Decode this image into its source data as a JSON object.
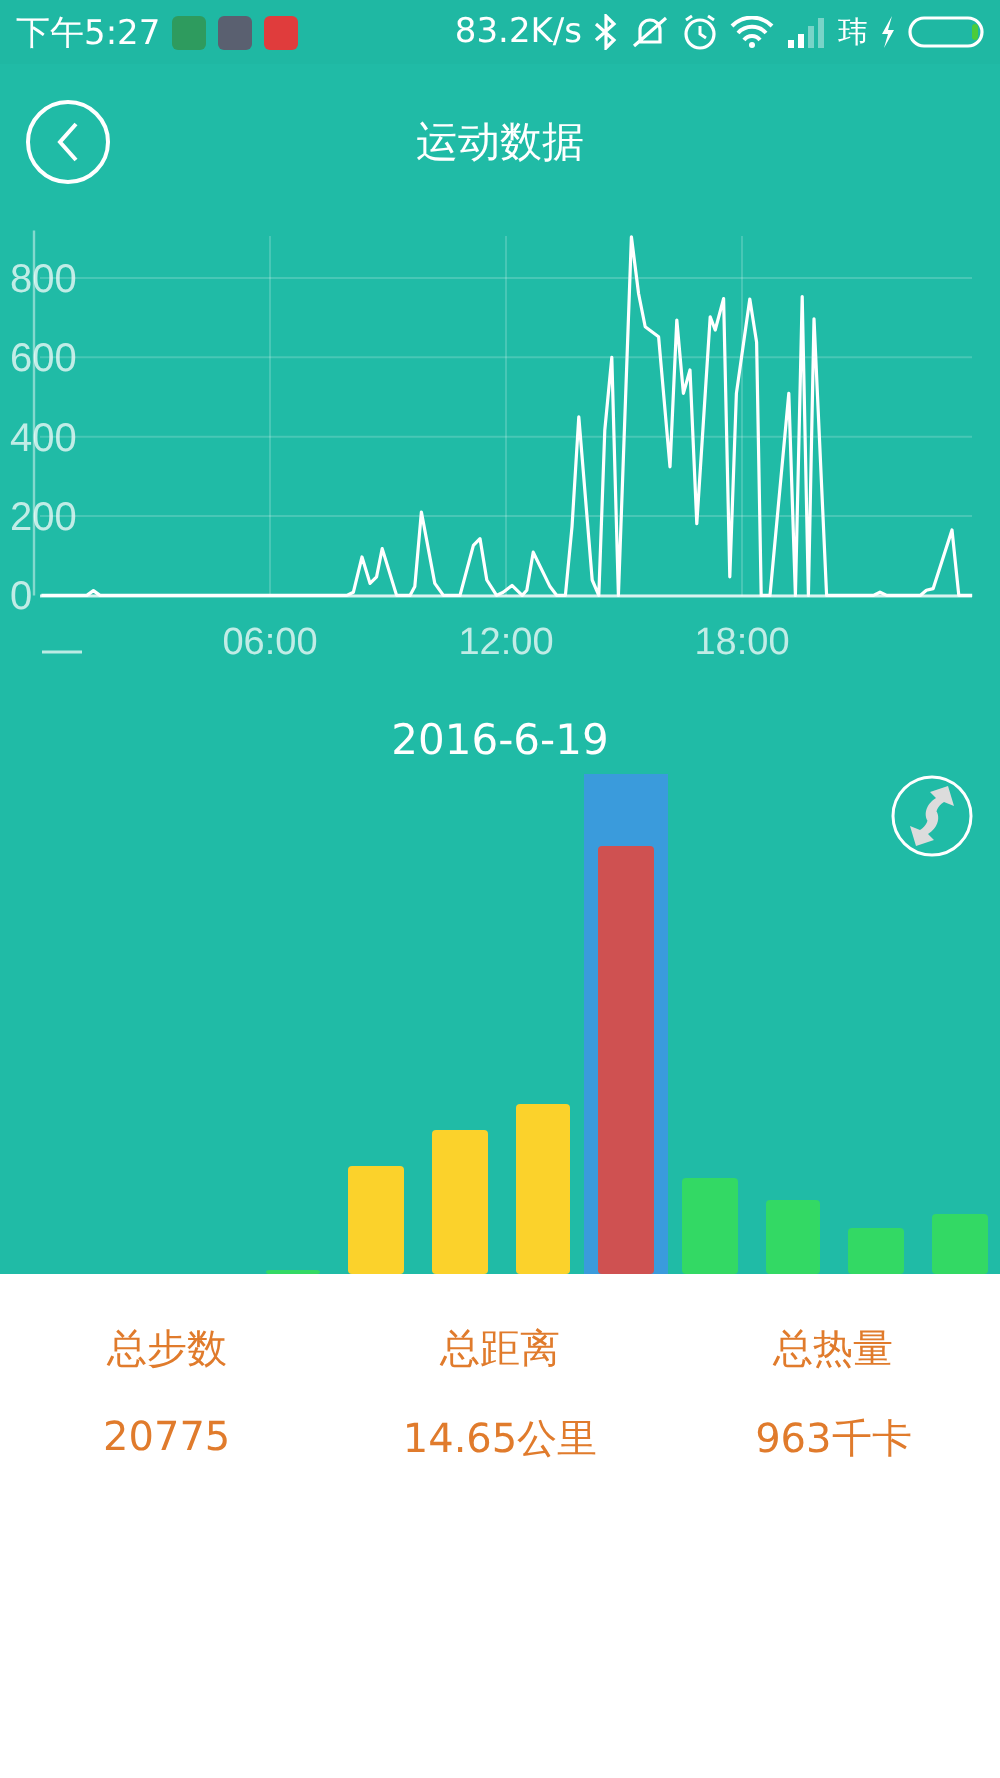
{
  "status_bar": {
    "time": "下午5:27",
    "net_speed": "83.2K/s",
    "carrier": "玮"
  },
  "header": {
    "title": "运动数据"
  },
  "activity_chart": {
    "chart_data": {
      "type": "line",
      "grid": true,
      "xlim": [
        0,
        24
      ],
      "ylim": [
        0,
        920
      ],
      "xticks": [
        {
          "value": 6,
          "label": "06:00"
        },
        {
          "value": 12,
          "label": "12:00"
        },
        {
          "value": 18,
          "label": "18:00"
        }
      ],
      "yticks": [
        0,
        200,
        400,
        600,
        800
      ],
      "x": [
        0.19,
        1.34,
        1.51,
        1.68,
        7.95,
        8.12,
        8.34,
        8.54,
        8.71,
        8.85,
        9.22,
        9.56,
        9.68,
        9.85,
        10.19,
        10.41,
        10.83,
        11.17,
        11.34,
        11.51,
        11.76,
        11.93,
        12.15,
        12.41,
        12.53,
        12.69,
        13.12,
        13.29,
        13.51,
        13.68,
        13.85,
        14.19,
        14.36,
        14.51,
        14.69,
        14.86,
        15.19,
        15.37,
        15.54,
        15.88,
        16.17,
        16.34,
        16.51,
        16.68,
        16.85,
        17.19,
        17.32,
        17.53,
        17.69,
        17.86,
        18.2,
        18.37,
        18.49,
        18.71,
        19.19,
        19.36,
        19.53,
        19.69,
        19.83,
        20.15,
        21.34,
        21.51,
        21.68,
        22.53,
        22.69,
        22.86,
        23.34,
        23.51,
        23.85
      ],
      "series": [
        {
          "color": "#ffffff",
          "values": [
            0,
            0,
            12,
            0,
            0,
            8,
            97,
            30,
            47,
            118,
            0,
            0,
            22,
            210,
            30,
            0,
            0,
            126,
            143,
            39,
            0,
            8,
            25,
            0,
            13,
            109,
            22,
            0,
            0,
            173,
            450,
            39,
            0,
            417,
            600,
            0,
            904,
            760,
            677,
            652,
            324,
            694,
            509,
            568,
            181,
            702,
            669,
            748,
            47,
            509,
            747,
            638,
            0,
            0,
            509,
            0,
            753,
            0,
            697,
            0,
            0,
            8,
            0,
            0,
            13,
            17,
            165,
            0,
            0
          ]
        }
      ]
    }
  },
  "day": {
    "date": "2016-6-19"
  },
  "totals": [
    {
      "label": "总步数",
      "value": "20775"
    },
    {
      "label": "总距离",
      "value": "14.65公里"
    },
    {
      "label": "总热量",
      "value": "963千卡"
    }
  ]
}
